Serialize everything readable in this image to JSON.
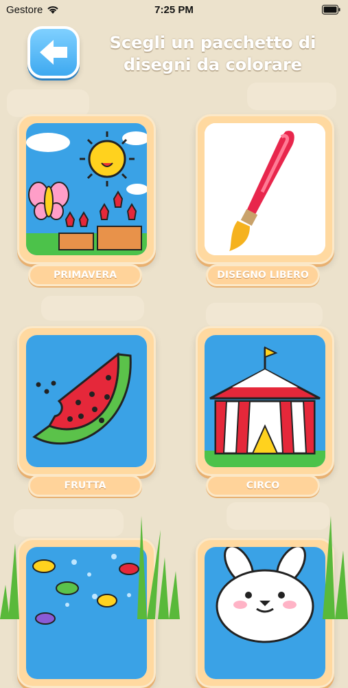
{
  "status": {
    "carrier": "Gestore",
    "time": "7:25 PM"
  },
  "header": {
    "title": "Scegli un pacchetto di disegni da colorare"
  },
  "packs": [
    {
      "label": "PRIMAVERA"
    },
    {
      "label": "DISEGNO LIBERO"
    },
    {
      "label": "FRUTTA"
    },
    {
      "label": "CIRCO"
    },
    {
      "label": ""
    },
    {
      "label": ""
    }
  ],
  "colors": {
    "accent": "#3ea9f0",
    "card": "#ffd9a0",
    "background": "#ece2cc"
  }
}
